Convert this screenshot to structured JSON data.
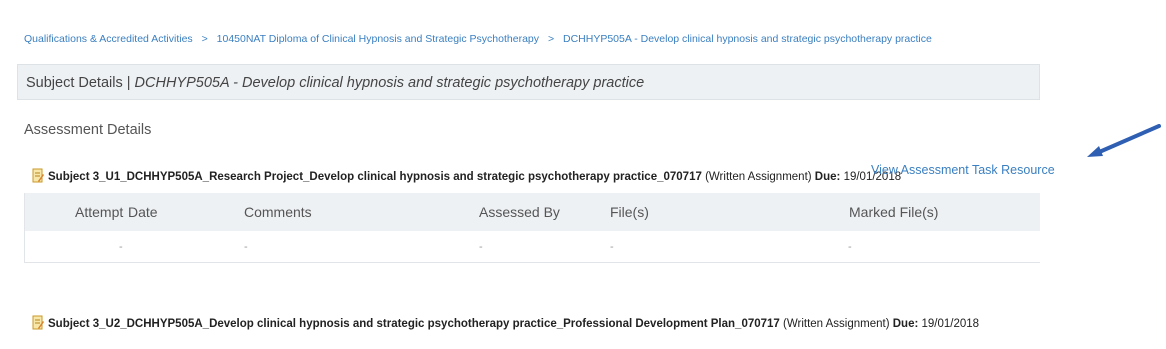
{
  "breadcrumb": {
    "items": [
      "Qualifications & Accredited Activities",
      "10450NAT Diploma of Clinical Hypnosis and Strategic Psychotherapy",
      "DCHHYP505A - Develop clinical hypnosis and strategic psychotherapy practice"
    ],
    "separator": ">"
  },
  "subject": {
    "prefix": "Subject Details | ",
    "code_title": "DCHHYP505A - Develop clinical hypnosis and strategic psychotherapy practice"
  },
  "assessment": {
    "heading": "Assessment Details",
    "view_resource_label": "View Assessment Task Resource",
    "tasks": [
      {
        "name": "Subject 3_U1_DCHHYP505A_Research Project_Develop clinical hypnosis and strategic psychotherapy practice_070717",
        "type": "(Written Assignment)",
        "due_label": "Due:",
        "due_date": "19/01/2018"
      },
      {
        "name": "Subject 3_U2_DCHHYP505A_Develop clinical hypnosis and strategic psychotherapy practice_Professional Development Plan_070717",
        "type": "(Written Assignment)",
        "due_label": "Due:",
        "due_date": "19/01/2018"
      }
    ],
    "table": {
      "columns": [
        "Attempt",
        "Date",
        "Comments",
        "Assessed By",
        "File(s)",
        "Marked File(s)"
      ],
      "row": [
        "-",
        "-",
        "-",
        "-",
        "-",
        "-"
      ]
    }
  },
  "icons": {
    "task_icon": "assignment-document-icon",
    "arrow": "pointer-arrow-icon"
  },
  "colors": {
    "link": "#3a7fc1",
    "header_bg": "#eef1f4",
    "arrow": "#2f5fb3"
  }
}
